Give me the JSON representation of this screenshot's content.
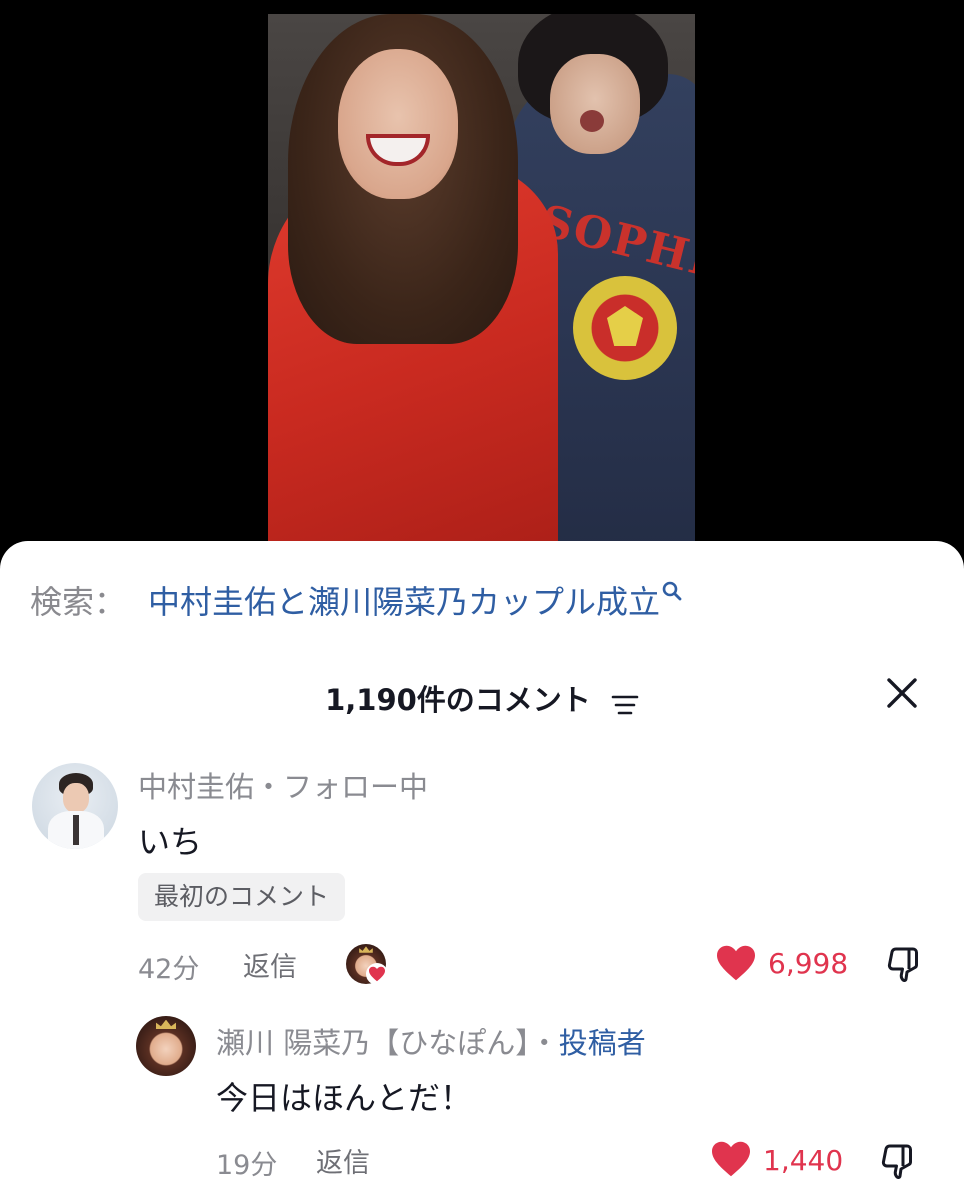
{
  "search": {
    "label": "検索：",
    "query": "中村圭佑と瀬川陽菜乃カップル成立"
  },
  "header": {
    "comment_count": "1,190件のコメント"
  },
  "comments": [
    {
      "username": "中村圭佑・フォロー中",
      "text": "いち",
      "badge": "最初のコメント",
      "time": "42分",
      "reply_label": "返信",
      "likes": "6,998"
    },
    {
      "username_main": "瀬川 陽菜乃【ひなぽん】・",
      "username_badge": "投稿者",
      "text": "今日はほんとだ！",
      "time": "19分",
      "reply_label": "返信",
      "likes": "1,440"
    }
  ],
  "video": {
    "hoodie_print": "SOPHIA"
  },
  "colors": {
    "link": "#2f5ea3",
    "like": "#e0344e",
    "muted_text": "#8a8b91"
  }
}
